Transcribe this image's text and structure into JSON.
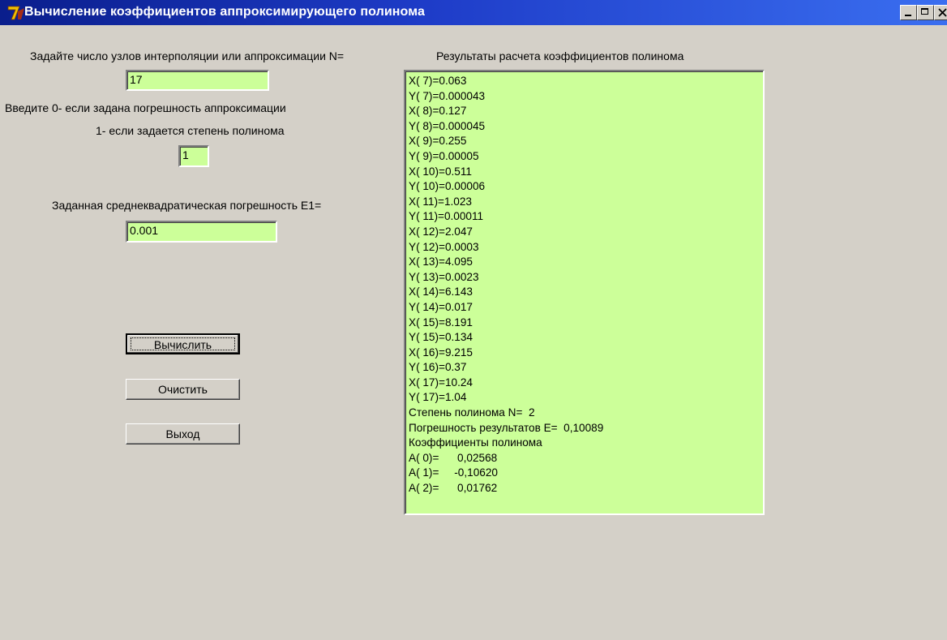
{
  "window": {
    "title": "Вычисление коэффициентов аппроксимирующего полинома"
  },
  "form": {
    "nodes_label": "Задайте число узлов интерполяции или аппроксимации N=",
    "nodes_value": "17",
    "mode_label_line1": "Введите 0- если задана погрешность аппроксимации",
    "mode_label_line2": "1- если задается степень полинома",
    "mode_value": "1",
    "error_label": "Заданная среднеквадратическая погрешность E1=",
    "error_value": "0.001"
  },
  "buttons": {
    "calculate": "Вычислить",
    "clear": "Очистить",
    "exit": "Выход"
  },
  "results": {
    "header": "Результаты расчета коэффициентов полинома",
    "lines": [
      "X( 7)=0.063",
      "Y( 7)=0.000043",
      "X( 8)=0.127",
      "Y( 8)=0.000045",
      "X( 9)=0.255",
      "Y( 9)=0.00005",
      "X( 10)=0.511",
      "Y( 10)=0.00006",
      "X( 11)=1.023",
      "Y( 11)=0.00011",
      "X( 12)=2.047",
      "Y( 12)=0.0003",
      "X( 13)=4.095",
      "Y( 13)=0.0023",
      "X( 14)=6.143",
      "Y( 14)=0.017",
      "X( 15)=8.191",
      "Y( 15)=0.134",
      "X( 16)=9.215",
      "Y( 16)=0.37",
      "X( 17)=10.24",
      "Y( 17)=1.04",
      "Степень полинома N=  2",
      "Погрешность результатов E=  0,10089",
      "Коэффициенты полинома",
      "A( 0)=      0,02568",
      "A( 1)=     -0,10620",
      "A( 2)=      0,01762"
    ]
  }
}
